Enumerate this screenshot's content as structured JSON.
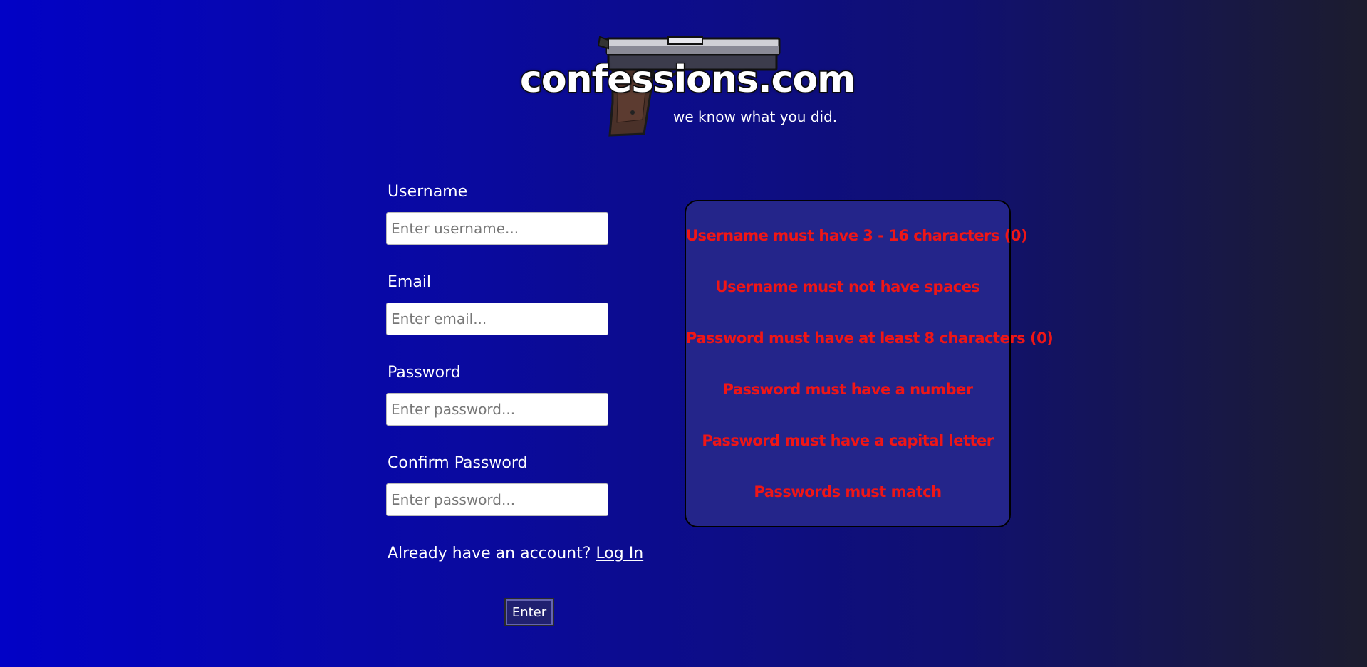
{
  "header": {
    "logo_text": "confessions.com",
    "tagline": "we know what you did.",
    "logo_image": "pistol-icon"
  },
  "form": {
    "username": {
      "label": "Username",
      "placeholder": "Enter username...",
      "value": ""
    },
    "email": {
      "label": "Email",
      "placeholder": "Enter email...",
      "value": ""
    },
    "password": {
      "label": "Password",
      "placeholder": "Enter password...",
      "value": ""
    },
    "confirm_password": {
      "label": "Confirm Password",
      "placeholder": "Enter password...",
      "value": ""
    },
    "login_prompt": "Already have an account?",
    "login_link": "Log In",
    "submit_label": "Enter"
  },
  "validation": {
    "rules": [
      "Username must have 3 - 16 characters (0)",
      "Username must not have spaces",
      "Password must have at least 8 characters (0)",
      "Password must have a number",
      "Password must have a capital letter",
      "Passwords must match"
    ]
  },
  "colors": {
    "background_start": "#0202c6",
    "background_end": "#1c1c2e",
    "rules_panel": "#24258a",
    "rule_text": "#ef1616"
  }
}
